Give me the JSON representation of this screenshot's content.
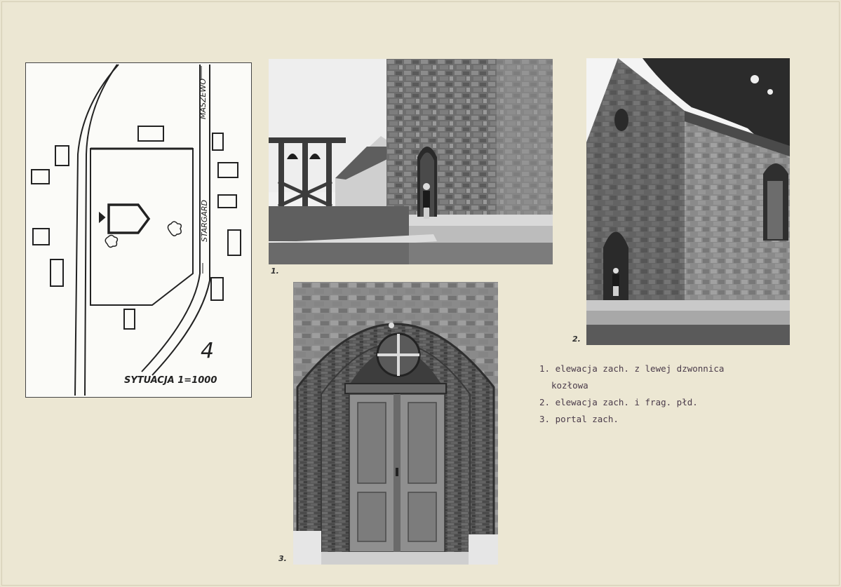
{
  "plan": {
    "street_top": "MASZEWO",
    "street_right": "STARGARD",
    "scale_label": "SYTUACJA 1=1000",
    "sheet_number": "4"
  },
  "photo_numbers": {
    "p1": "1.",
    "p2": "2.",
    "p3": "3."
  },
  "captions": {
    "c1_line1": "1. elewacja zach. z lewej dzwonnica",
    "c1_line2": "kozłowa",
    "c2": "2. elewacja zach. i frag. płd.",
    "c3": "3. portal zach."
  }
}
